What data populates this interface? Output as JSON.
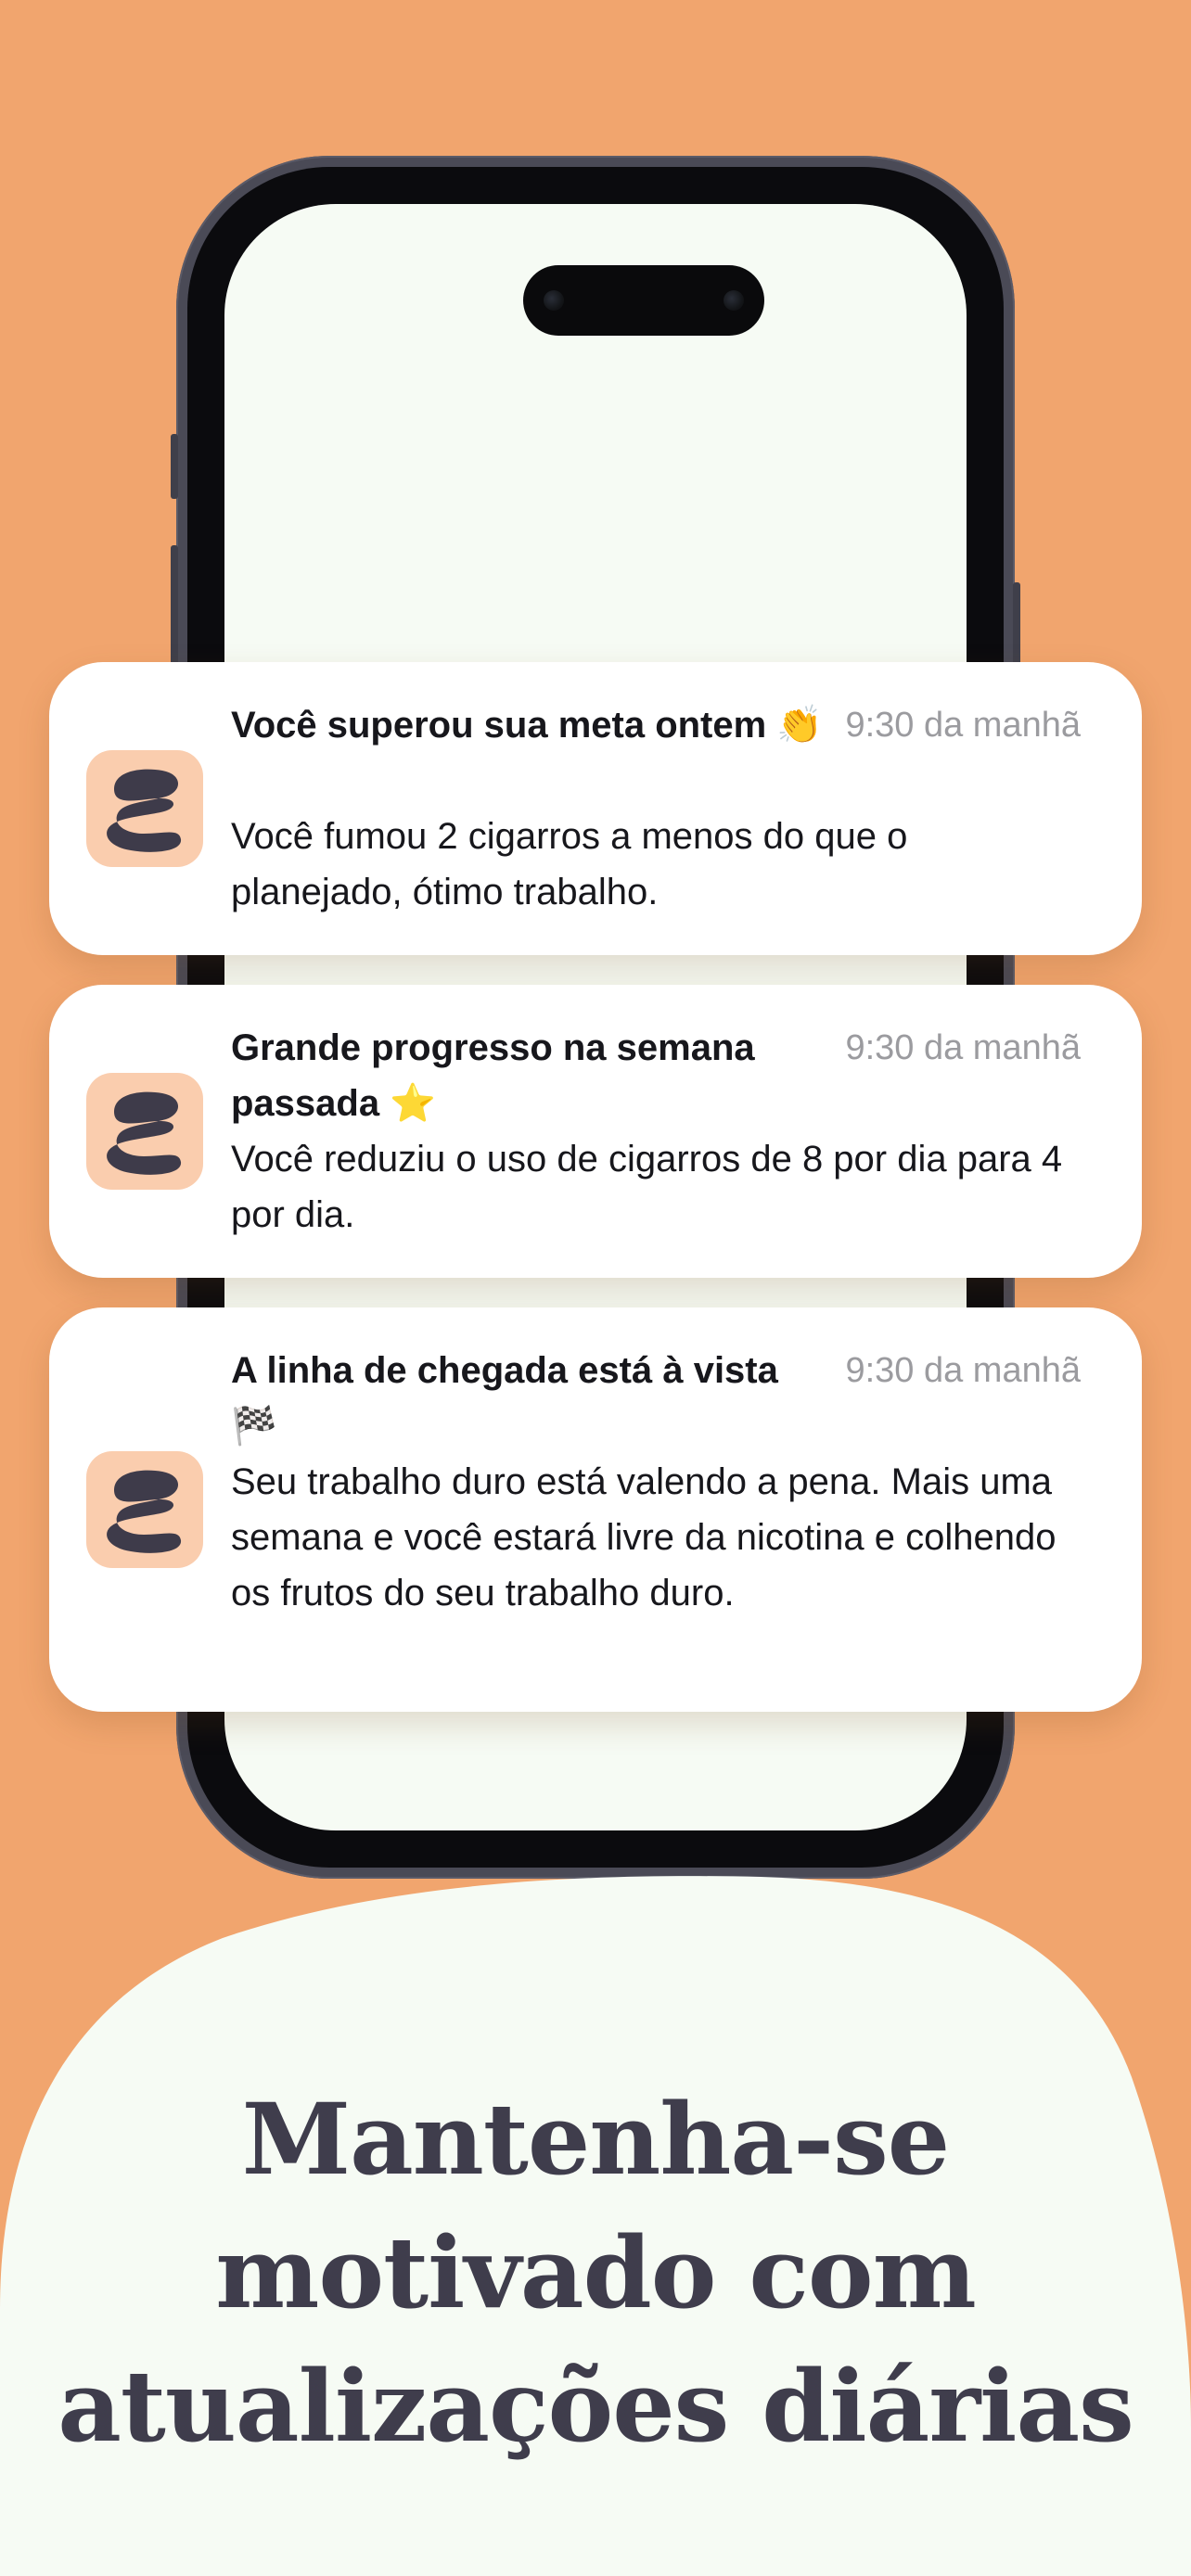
{
  "colors": {
    "background": "#F1A56E",
    "blob": "#F6FBF4",
    "headline": "#3F3D4C",
    "app_icon_bg": "#FACDAE",
    "app_icon_fg": "#3E3B4A",
    "notification_time": "#9B9B9F"
  },
  "notifications": [
    {
      "title": "Você superou sua meta ontem 👏",
      "time": "9:30 da manhã",
      "body": "Você fumou 2 cigarros a menos do que o planejado, ótimo trabalho.",
      "icon": "app-logo-icon"
    },
    {
      "title": "Grande progresso na semana passada ⭐",
      "time": "9:30 da manhã",
      "body": "Você reduziu o uso de cigarros de 8 por dia para 4 por dia.",
      "icon": "app-logo-icon"
    },
    {
      "title": "A linha de chegada está à vista 🏁",
      "time": "9:30 da manhã",
      "body": "Seu trabalho duro está valendo a pena. Mais uma semana e você estará livre da nicotina e colhendo os frutos do seu trabalho duro.",
      "icon": "app-logo-icon"
    }
  ],
  "headline": {
    "line1": "Mantenha-se",
    "line2": "motivado com",
    "line3": "atualizações diárias"
  }
}
